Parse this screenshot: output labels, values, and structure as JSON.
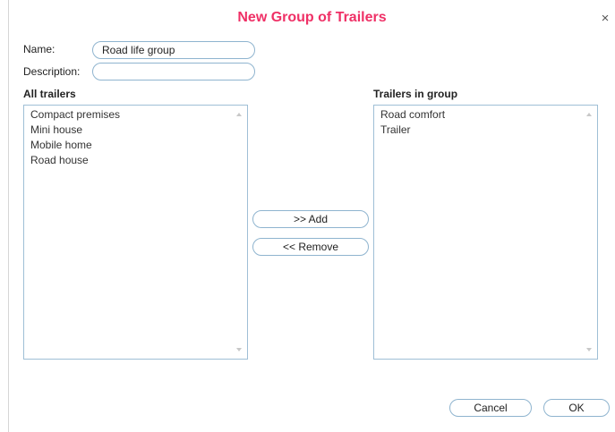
{
  "dialog": {
    "title": "New Group of Trailers",
    "close_glyph": "×"
  },
  "form": {
    "name_label": "Name:",
    "name_value": "Road life group",
    "description_label": "Description:",
    "description_value": ""
  },
  "all_trailers": {
    "heading": "All trailers",
    "items": [
      {
        "label": "Compact premises"
      },
      {
        "label": "Mini house"
      },
      {
        "label": "Mobile home"
      },
      {
        "label": "Road house"
      }
    ]
  },
  "group_trailers": {
    "heading": "Trailers in group",
    "items": [
      {
        "label": "Road comfort"
      },
      {
        "label": "Trailer"
      }
    ]
  },
  "actions": {
    "add_label": ">> Add",
    "remove_label": "<< Remove",
    "cancel_label": "Cancel",
    "ok_label": "OK"
  },
  "colors": {
    "title": "#ef3066",
    "border_accent": "#8fb4cf"
  },
  "icons": {
    "close": "close-icon",
    "scroll_up": "chevron-up-icon",
    "scroll_down": "chevron-down-icon"
  }
}
